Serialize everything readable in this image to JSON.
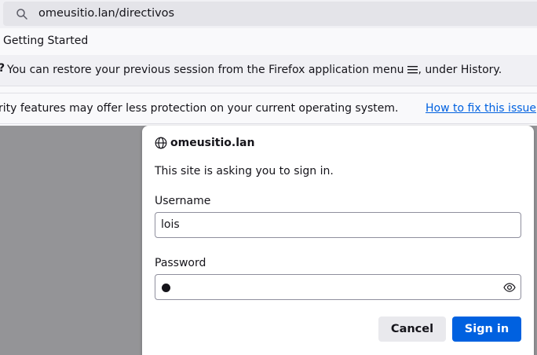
{
  "urlbar": {
    "url": "omeusitio.lan/directivos",
    "search_icon": "search-icon"
  },
  "bookmarks": {
    "items": [
      {
        "label": "Getting Started"
      }
    ]
  },
  "session_notice": {
    "icon": "?",
    "text_before": "You can restore your previous session from the Firefox application menu",
    "menu_icon": "hamburger-menu-icon",
    "text_after": ", under History."
  },
  "security_notice": {
    "text": "rity features may offer less protection on your current operating system.",
    "link": "How to fix this issue"
  },
  "auth_dialog": {
    "site_icon": "globe-icon",
    "site": "omeusitio.lan",
    "prompt": "This site is asking you to sign in.",
    "username_label": "Username",
    "username_value": "lois",
    "password_label": "Password",
    "password_reveal_icon": "eye-icon",
    "cancel_label": "Cancel",
    "signin_label": "Sign in"
  },
  "colors": {
    "accent": "#0061e0",
    "overlay": "#949497",
    "toolbar": "#f0f0f4"
  }
}
